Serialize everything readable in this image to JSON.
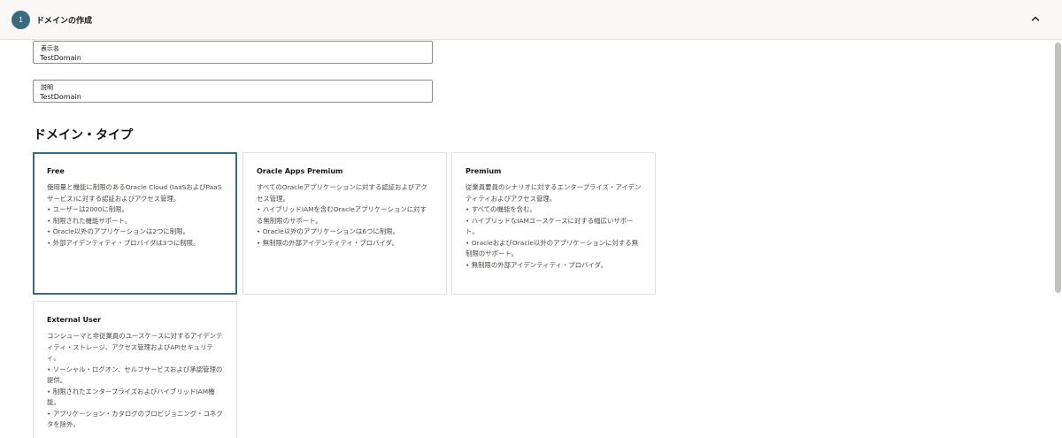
{
  "header": {
    "step_number": "1",
    "title": "ドメインの作成",
    "collapse_icon": "chevron-up-icon"
  },
  "form": {
    "display_name": {
      "label": "表示名",
      "value": "TestDomain"
    },
    "description": {
      "label": "説明",
      "value": "TestDomain"
    }
  },
  "domain_type": {
    "heading": "ドメイン・タイプ",
    "cards": [
      {
        "title": "Free",
        "selected": true,
        "lines": [
          "使用量と機能に制限のあるOracle Cloud (IaaSおよびPaaSサービス)に対する認証およびアクセス管理。",
          "• ユーザーは2000に制限。",
          "• 制限された機能サポート。",
          "• Oracle以外のアプリケーションは2つに制限。",
          "• 外部アイデンティティ・プロバイダは3つに制限。"
        ]
      },
      {
        "title": "Oracle Apps Premium",
        "selected": false,
        "lines": [
          "すべてのOracleアプリケーションに対する認証およびアクセス管理。",
          "• ハイブリッドIAMを含むOracleアプリケーションに対する無制限のサポート。",
          "• Oracle以外のアプリケーションは6つに制限。",
          "• 無制限の外部アイデンティティ・プロバイダ。"
        ]
      },
      {
        "title": "Premium",
        "selected": false,
        "lines": [
          "従業員要員のシナリオに対するエンタープライズ・アイデンティティおよびアクセス管理。",
          "• すべての機能を含む。",
          "• ハイブリッドなIAMユースケースに対する幅広いサポート。",
          "• OracleおよびOracle以外のアプリケーションに対する無制限のサポート。",
          "• 無制限の外部アイデンティティ・プロバイダ。"
        ]
      },
      {
        "title": "External User",
        "selected": false,
        "lines": [
          "コンシューマと非従業員のユースケースに対するアイデンティティ・ストレージ、アクセス管理およびAPIセキュリティ。",
          "• ソーシャル・ログオン、セルフサービスおよび承認管理の提供。",
          "• 制限されたエンタープライズおよびハイブリッドIAM機能。",
          "• アプリケーション・カタログのプロビジョニング・コネクタを除外。"
        ]
      }
    ]
  },
  "colors": {
    "accent": "#3b6a80",
    "border": "#8f8b86",
    "header_bg": "#f9f8f6"
  }
}
